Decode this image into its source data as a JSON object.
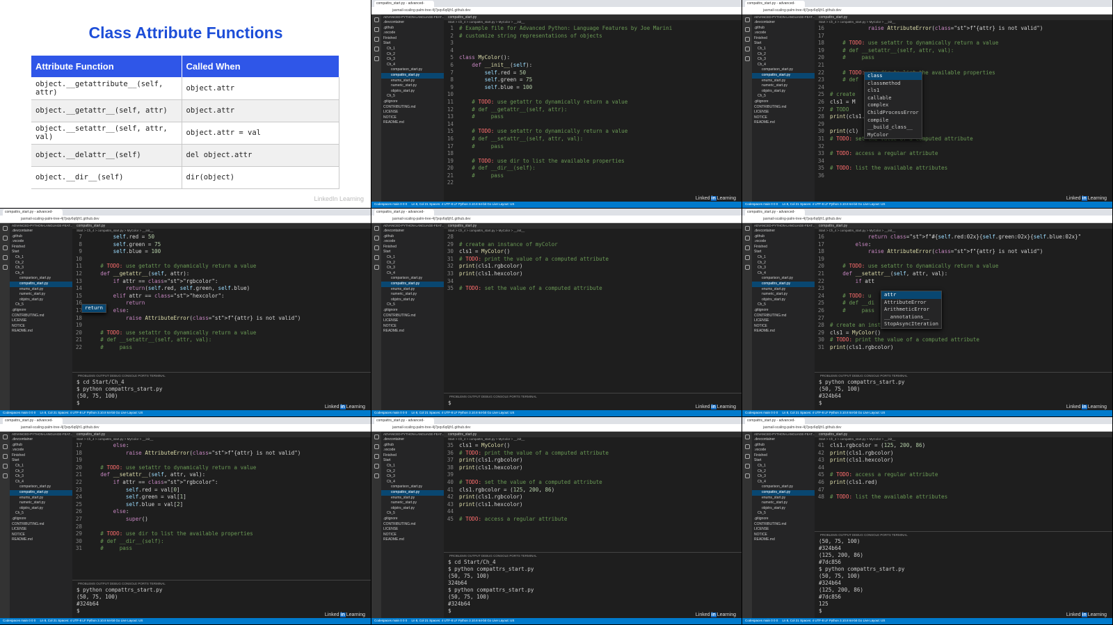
{
  "slide": {
    "title": "Class Attribute Functions",
    "headers": [
      "Attribute Function",
      "Called When"
    ],
    "rows": [
      [
        "object.__getattribute__(self, attr)",
        "object.attr"
      ],
      [
        "object.__getattr__(self, attr)",
        "object.attr"
      ],
      [
        "object.__setattr__(self, attr, val)",
        "object.attr = val"
      ],
      [
        "object.__delattr__(self)",
        "del object.attr"
      ],
      [
        "object.__dir__(self)",
        "dir(object)"
      ]
    ],
    "watermark": "LinkedIn Learning"
  },
  "common": {
    "tab_label": "compattrs_start.py - advanced-",
    "address": "jasmail-scaling-palm-tree-4j7jxqv6q6jfr1.github.dev",
    "editor_tab": "compattrs_start.py",
    "breadcrumb": "Start > Ch_4 > compattrs_start.py > MyColor > __init__",
    "status_left": "Codespaces  main  0  0  0",
    "status_right": "Ln 8, Col 21  Spaces: 4  UTF-8  LF  Python  3.10.8 64-bit  Go Live  Layout: US",
    "terminal_header": "PROBLEMS  OUTPUT  DEBUG CONSOLE  PORTS  TERMINAL",
    "badge_text": "Linked",
    "badge_in": "in",
    "badge_tail": "Learning",
    "sidebar_header": "ADVANCED-PYTHON-LANGUAGE-FEAT...",
    "sidebar_items": [
      ".devcontainer",
      ".github",
      ".vscode",
      "Finished",
      "Start",
      "Ch_1",
      "Ch_2",
      "Ch_3",
      "Ch_4",
      "comparison_start.py",
      "compattrs_start.py",
      "enums_start.py",
      "numeric_start.py",
      "objstrs_start.py",
      "Ch_5",
      ".gitignore",
      "CONTRIBUTING.md",
      "LICENSE",
      "NOTICE",
      "README.md"
    ],
    "sidebar_selected": 10
  },
  "editors": [
    {
      "lines": [
        [
          "1",
          "# Example file for Advanced Python: Language Features by Joe Marini"
        ],
        [
          "2",
          "# customize string representations of objects"
        ],
        [
          "3",
          ""
        ],
        [
          "4",
          ""
        ],
        [
          "5",
          "class MyColor():"
        ],
        [
          "6",
          "    def __init__(self):"
        ],
        [
          "7",
          "        self.red = 50"
        ],
        [
          "8",
          "        self.green = 75"
        ],
        [
          "9",
          "        self.blue = 100"
        ],
        [
          "10",
          ""
        ],
        [
          "11",
          "    # TODO: use getattr to dynamically return a value"
        ],
        [
          "12",
          "    # def __getattr__(self, attr):"
        ],
        [
          "13",
          "    #     pass"
        ],
        [
          "14",
          ""
        ],
        [
          "15",
          "    # TODO: use setattr to dynamically return a value"
        ],
        [
          "16",
          "    # def __setattr__(self, attr, val):"
        ],
        [
          "17",
          "    #     pass"
        ],
        [
          "18",
          ""
        ],
        [
          "19",
          "    # TODO: use dir to list the available properties"
        ],
        [
          "20",
          "    # def __dir__(self):"
        ],
        [
          "21",
          "    #     pass"
        ],
        [
          "22",
          ""
        ]
      ],
      "terminal": []
    },
    {
      "lines": [
        [
          "16",
          "            raise AttributeError(f\"{attr} is not valid\")"
        ],
        [
          "17",
          ""
        ],
        [
          "18",
          "    # TODO: use setattr to dynamically return a value"
        ],
        [
          "19",
          "    # def __setattr__(self, attr, val):"
        ],
        [
          "20",
          "    #     pass"
        ],
        [
          "21",
          ""
        ],
        [
          "22",
          "    # TODO: use dir to list the available properties"
        ],
        [
          "23",
          "    # def"
        ],
        [
          "24",
          ""
        ],
        [
          "25",
          "# create"
        ],
        [
          "26",
          "cls1 = M"
        ],
        [
          "27",
          "# TODO"
        ],
        [
          "28",
          "print(cls1.hexcolor)"
        ],
        [
          "29",
          ""
        ],
        [
          "30",
          "print(cl)"
        ],
        [
          "31",
          "# TODO: set the value of a computed attribute"
        ],
        [
          "32",
          ""
        ],
        [
          "33",
          "# TODO: access a regular attribute"
        ],
        [
          "34",
          ""
        ],
        [
          "35",
          "# TODO: list the available attributes"
        ],
        [
          "36",
          ""
        ]
      ],
      "autocomplete": [
        "class",
        "classmethod",
        "cls1",
        "callable",
        "complex",
        "ChildProcessError",
        "compile",
        "__build_class__",
        "MyColor"
      ],
      "terminal": []
    },
    {
      "lines": [
        [
          "7",
          "        self.red = 50"
        ],
        [
          "8",
          "        self.green = 75"
        ],
        [
          "9",
          "        self.blue = 100"
        ],
        [
          "10",
          ""
        ],
        [
          "11",
          "    # TODO: use getattr to dynamically return a value"
        ],
        [
          "12",
          "    def __getattr__(self, attr):"
        ],
        [
          "13",
          "        if attr == \"rgbcolor\":"
        ],
        [
          "14",
          "            return(self.red, self.green, self.blue)"
        ],
        [
          "15",
          "        elif attr == \"hexcolor\":"
        ],
        [
          "16",
          "            return"
        ],
        [
          "17",
          "        else:"
        ],
        [
          "18",
          "            raise AttributeError(f\"{attr} is not valid\")"
        ],
        [
          "19",
          ""
        ],
        [
          "20",
          "    # TODO: use setattr to dynamically return a value"
        ],
        [
          "21",
          "    # def __setattr__(self, attr, val):"
        ],
        [
          "22",
          "    #     pass"
        ]
      ],
      "autocomplete": [
        "return"
      ],
      "terminal": [
        "$ cd Start/Ch_4",
        "$ python compattrs_start.py",
        "(50, 75, 100)",
        "$ "
      ]
    },
    {
      "lines": [
        [
          "28",
          ""
        ],
        [
          "29",
          "# create an instance of myColor"
        ],
        [
          "30",
          "cls1 = MyColor()"
        ],
        [
          "31",
          "# TODO: print the value of a computed attribute"
        ],
        [
          "32",
          "print(cls1.rgbcolor)"
        ],
        [
          "33",
          "print(cls1.hexcolor)"
        ],
        [
          "34",
          ""
        ],
        [
          "35",
          "# TODO: set the value of a computed attribute"
        ]
      ],
      "terminal": [
        "$ "
      ]
    },
    {
      "lines": [
        [
          "16",
          "            return f\"#{self.red:02x}{self.green:02x}{self.blue:02x}\""
        ],
        [
          "17",
          "        else:"
        ],
        [
          "18",
          "            raise AttributeError(f\"{attr} is not valid\")"
        ],
        [
          "19",
          ""
        ],
        [
          "20",
          "    # TODO: use setattr to dynamically return a value"
        ],
        [
          "21",
          "    def __setattr__(self, attr, val):"
        ],
        [
          "22",
          "        if att"
        ],
        [
          "23",
          ""
        ],
        [
          "24",
          "    # TODO: u"
        ],
        [
          "25",
          "    # def __di"
        ],
        [
          "26",
          "    #     pass"
        ],
        [
          "27",
          ""
        ],
        [
          "28",
          "# create an instance of myColor"
        ],
        [
          "29",
          "cls1 = MyColor()"
        ],
        [
          "30",
          "# TODO: print the value of a computed attribute"
        ],
        [
          "31",
          "print(cls1.rgbcolor)"
        ]
      ],
      "autocomplete": [
        "attr",
        "AttributeError",
        "ArithmeticError",
        "__annotations__",
        "StopAsyncIteration"
      ],
      "terminal": [
        "$ python compattrs_start.py",
        "(50, 75, 100)",
        "#324b64",
        "$ "
      ]
    },
    {
      "lines": [
        [
          "17",
          "        else:"
        ],
        [
          "18",
          "            raise AttributeError(f\"{attr} is not valid\")"
        ],
        [
          "19",
          ""
        ],
        [
          "20",
          "    # TODO: use setattr to dynamically return a value"
        ],
        [
          "21",
          "    def __setattr__(self, attr, val):"
        ],
        [
          "22",
          "        if attr == \"rgbcolor\":"
        ],
        [
          "23",
          "            self.red = val[0]"
        ],
        [
          "24",
          "            self.green = val[1]"
        ],
        [
          "25",
          "            self.blue = val[2]"
        ],
        [
          "26",
          "        else:"
        ],
        [
          "27",
          "            super()"
        ],
        [
          "28",
          ""
        ],
        [
          "29",
          "    # TODO: use dir to list the available properties"
        ],
        [
          "30",
          "    # def __dir__(self):"
        ],
        [
          "31",
          "    #     pass"
        ]
      ],
      "terminal": [
        "$ python compattrs_start.py",
        "(50, 75, 100)",
        "#324b64",
        "$ "
      ]
    },
    {
      "lines": [
        [
          "35",
          "cls1 = MyColor()"
        ],
        [
          "36",
          "# TODO: print the value of a computed attribute"
        ],
        [
          "37",
          "print(cls1.rgbcolor)"
        ],
        [
          "38",
          "print(cls1.hexcolor)"
        ],
        [
          "39",
          ""
        ],
        [
          "40",
          "# TODO: set the value of a computed attribute"
        ],
        [
          "41",
          "cls1.rgbcolor = (125, 200, 86)"
        ],
        [
          "42",
          "print(cls1.rgbcolor)"
        ],
        [
          "43",
          "print(cls1.hexcolor)"
        ],
        [
          "44",
          ""
        ],
        [
          "45",
          "# TODO: access a regular attribute"
        ]
      ],
      "terminal": [
        "$ cd Start/Ch_4",
        "$ python compattrs_start.py",
        "(50, 75, 100)",
        "324b64",
        "$ python compattrs_start.py",
        "(50, 75, 100)",
        "#324b64",
        "$ "
      ]
    },
    {
      "lines": [
        [
          "41",
          "cls1.rgbcolor = (125, 200, 86)"
        ],
        [
          "42",
          "print(cls1.rgbcolor)"
        ],
        [
          "43",
          "print(cls1.hexcolor)"
        ],
        [
          "44",
          ""
        ],
        [
          "45",
          "# TODO: access a regular attribute"
        ],
        [
          "46",
          "print(cls1.red)"
        ],
        [
          "47",
          ""
        ],
        [
          "48",
          "# TODO: list the available attributes"
        ]
      ],
      "terminal": [
        "(50, 75, 100)",
        "#324b64",
        "(125, 200, 86)",
        "#7dc856",
        "$ python compattrs_start.py",
        "(50, 75, 100)",
        "#324b64",
        "(125, 200, 86)",
        "#7dc856",
        "125",
        "$ "
      ]
    }
  ]
}
